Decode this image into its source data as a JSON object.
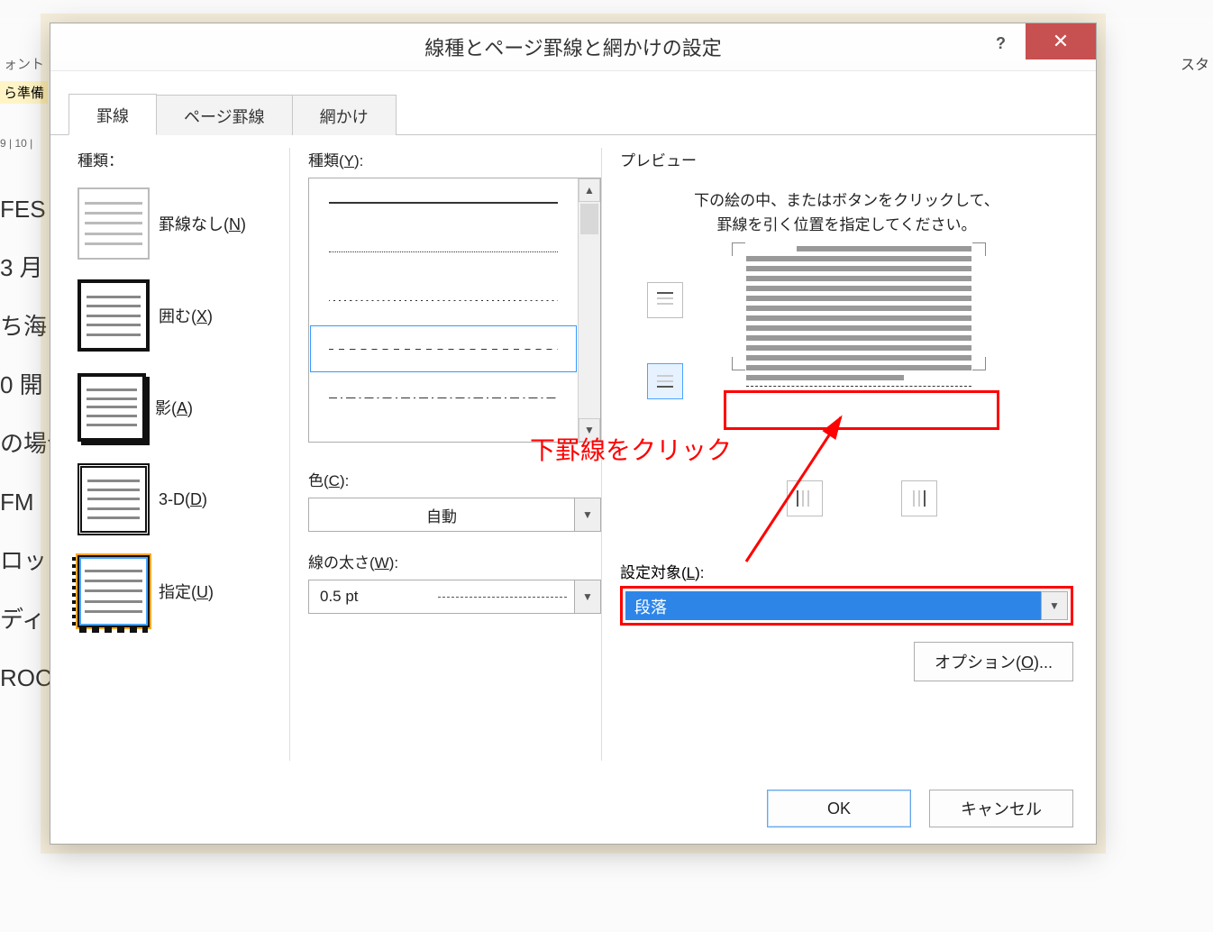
{
  "bg": {
    "label_font": "ォント",
    "label_prep": "ら準備",
    "ruler": "9 | 10 |",
    "doc_lines": [
      "FES",
      "3 月",
      "ち海",
      "0  開",
      "の場合",
      "FM",
      "ロッ",
      "ディ",
      "ROC"
    ],
    "style_hint": "スタ"
  },
  "dialog": {
    "title": "線種とページ罫線と網かけの設定",
    "tabs": {
      "borders": "罫線",
      "page": "ページ罫線",
      "shading": "網かけ"
    },
    "setting": {
      "header": "種類：",
      "none": "罫線なし(N)",
      "box": "囲む(X)",
      "shadow": "影(A)",
      "threeD": "3-D(D)",
      "custom": "指定(U)"
    },
    "style": {
      "header": "種類(Y):",
      "color_label": "色(C):",
      "color_value": "自動",
      "width_label": "線の太さ(W):",
      "width_value": "0.5 pt"
    },
    "preview": {
      "header": "プレビュー",
      "hint": "下の絵の中、またはボタンをクリックして、罫線を引く位置を指定してください。",
      "apply_label": "設定対象(L):",
      "apply_value": "段落",
      "options_btn": "オプション(O)..."
    },
    "annotation": "下罫線をクリック",
    "footer": {
      "ok": "OK",
      "cancel": "キャンセル"
    }
  }
}
